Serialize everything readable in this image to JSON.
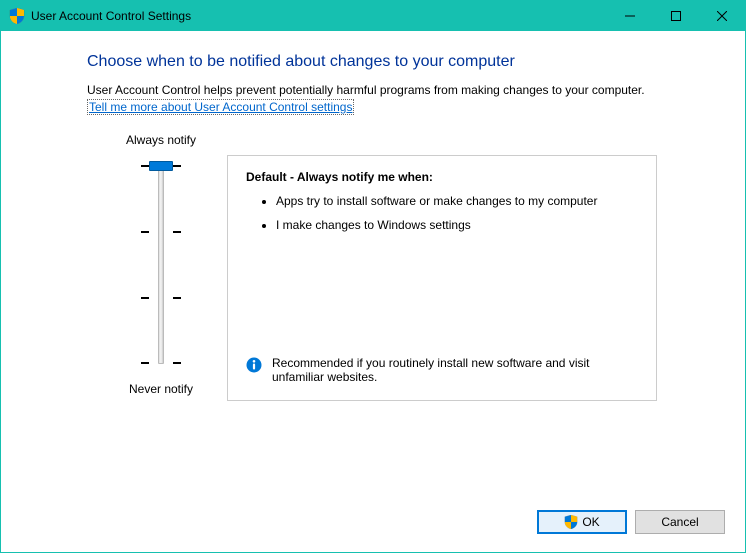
{
  "window": {
    "title": "User Account Control Settings"
  },
  "heading": "Choose when to be notified about changes to your computer",
  "intro": "User Account Control helps prevent potentially harmful programs from making changes to your computer.",
  "help_link": "Tell me more about User Account Control settings",
  "slider": {
    "top_label": "Always notify",
    "bottom_label": "Never notify",
    "levels": 4,
    "position_index": 0
  },
  "description": {
    "title": "Default - Always notify me when:",
    "bullets": [
      "Apps try to install software or make changes to my computer",
      "I make changes to Windows settings"
    ],
    "recommendation": "Recommended if you routinely install new software and visit unfamiliar websites."
  },
  "buttons": {
    "ok": "OK",
    "cancel": "Cancel"
  }
}
